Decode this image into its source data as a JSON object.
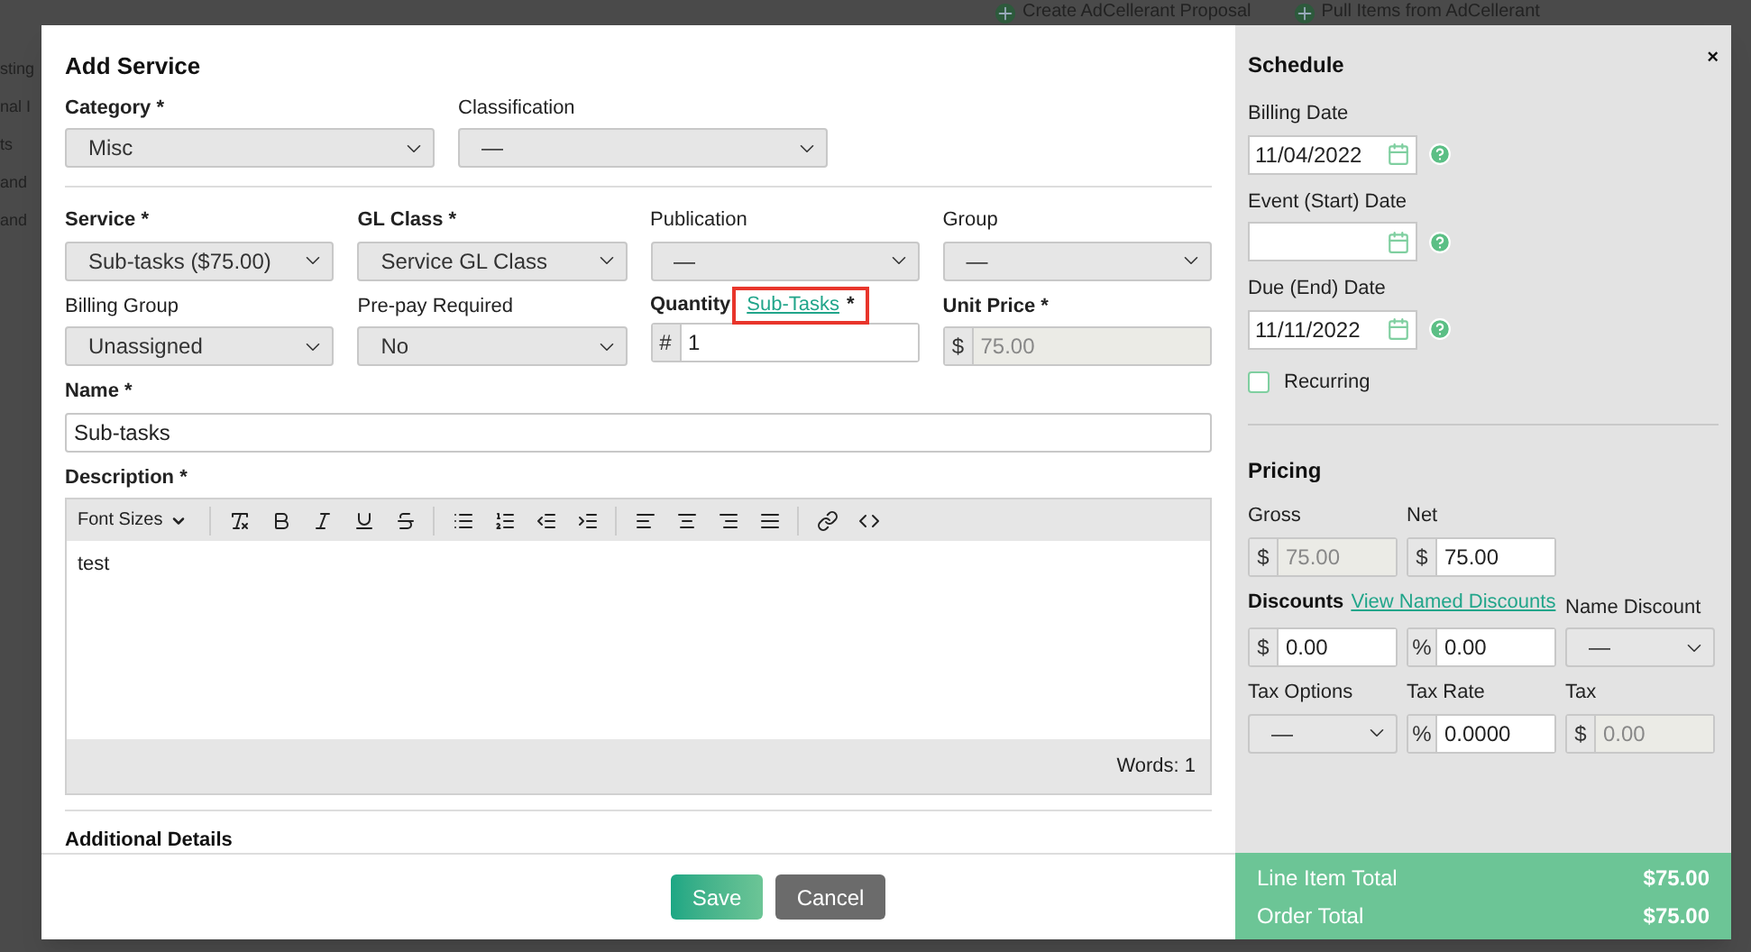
{
  "background": {
    "toolbar_buttons": [
      "Create AdCellerant Proposal",
      "Pull Items from AdCellerant"
    ],
    "sidebar_fragments": [
      "sting",
      "nal I",
      "ts",
      "and",
      "and"
    ]
  },
  "dialog": {
    "title": "Add Service",
    "close": "×",
    "top_fields": [
      {
        "label": "Category *",
        "required": true,
        "kind": "select",
        "value": "Misc"
      },
      {
        "label": "Classification",
        "required": false,
        "kind": "select",
        "value": "—"
      }
    ],
    "fields": [
      {
        "label": "Service *",
        "required": true,
        "kind": "select",
        "value": "Sub-tasks ($75.00)"
      },
      {
        "label": "GL Class *",
        "required": true,
        "kind": "select",
        "value": "Service GL Class"
      },
      {
        "label": "Publication",
        "required": false,
        "kind": "select",
        "value": "—"
      },
      {
        "label": "Group",
        "required": false,
        "kind": "select",
        "value": "—"
      },
      {
        "label": "Billing Group",
        "required": false,
        "kind": "select",
        "value": "Unassigned"
      },
      {
        "label": "Pre-pay Required",
        "required": false,
        "kind": "select",
        "value": "No"
      },
      {
        "label": "Quantity",
        "link": "Sub-Tasks",
        "suffix": "*",
        "highlighted": true,
        "required": true,
        "kind": "addon",
        "addon": "#",
        "value": "1",
        "disabled": false
      },
      {
        "label": "Unit Price *",
        "required": true,
        "kind": "addon",
        "addon": "$",
        "value": "75.00",
        "disabled": true
      }
    ],
    "name": {
      "label": "Name *",
      "value": "Sub-tasks"
    },
    "description": {
      "label": "Description *",
      "font_sizes": "Font Sizes",
      "content": "test",
      "word_count": "Words: 1"
    },
    "additional_details": "Additional Details",
    "buttons": [
      {
        "label": "Save",
        "kind": "primary"
      },
      {
        "label": "Cancel",
        "kind": "secondary"
      }
    ],
    "schedule": {
      "title": "Schedule",
      "dates": [
        {
          "label": "Billing Date",
          "value": "11/04/2022"
        },
        {
          "label": "Event (Start) Date"
        },
        {
          "label": "Due (End) Date",
          "value": "11/11/2022"
        }
      ],
      "recurring": {
        "label": "Recurring",
        "checked": false
      }
    },
    "pricing": {
      "title": "Pricing",
      "gross": {
        "label": "Gross",
        "addon": "$",
        "value": "75.00",
        "disabled": true
      },
      "net": {
        "label": "Net",
        "addon": "$",
        "value": "75.00",
        "disabled": false
      },
      "discounts_title": "Discounts",
      "discounts_link": "View Named Discounts",
      "discount_amount": {
        "addon": "$",
        "value": "0.00",
        "disabled": false
      },
      "discount_percent": {
        "addon": "%",
        "value": "0.00",
        "disabled": false
      },
      "name_discount": {
        "label": "Name Discount",
        "value": "—"
      },
      "tax_options": {
        "label": "Tax Options",
        "value": "—"
      },
      "tax_rate": {
        "label": "Tax Rate",
        "addon": "%",
        "value": "0.0000",
        "disabled": false
      },
      "tax": {
        "label": "Tax",
        "addon": "$",
        "value": "0.00",
        "disabled": true
      }
    },
    "totals": [
      {
        "label": "Line Item Total",
        "value": "$75.00"
      },
      {
        "label": "Order Total",
        "value": "$75.00"
      }
    ]
  }
}
